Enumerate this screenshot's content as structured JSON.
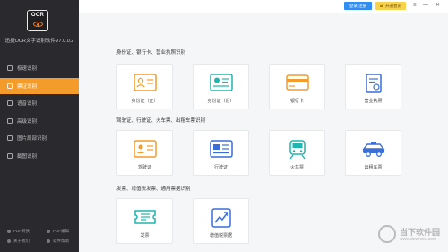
{
  "app": {
    "logo_text": "OCR",
    "title": "迅捷OCR文字识别软件V7.0.0.2"
  },
  "sidebar": {
    "items": [
      {
        "label": "极速识别",
        "active": false
      },
      {
        "label": "票证识别",
        "active": true
      },
      {
        "label": "语音识别",
        "active": false
      },
      {
        "label": "高级识别",
        "active": false
      },
      {
        "label": "图片局部识别",
        "active": false
      },
      {
        "label": "截图识别",
        "active": false
      }
    ],
    "footer": [
      "PDF转换",
      "PDF编辑",
      "关于我们",
      "软件帮助"
    ]
  },
  "topbar": {
    "login": "登录/注册",
    "vip": "开通会员",
    "menu": "≡",
    "minimize": "—",
    "close": "✕"
  },
  "sections": [
    {
      "title": "身份证、银行卡、营业执照识别",
      "cards": [
        {
          "label": "身份证（正）",
          "icon": "id-card-front-icon"
        },
        {
          "label": "身份证（反）",
          "icon": "id-card-back-icon"
        },
        {
          "label": "银行卡",
          "icon": "bank-card-icon"
        },
        {
          "label": "营业执照",
          "icon": "business-license-icon"
        }
      ]
    },
    {
      "title": "驾驶证、行驶证、火车票、出租车票识别",
      "cards": [
        {
          "label": "驾驶证",
          "icon": "driver-license-icon"
        },
        {
          "label": "行驶证",
          "icon": "vehicle-license-icon"
        },
        {
          "label": "火车票",
          "icon": "train-icon"
        },
        {
          "label": "出租车票",
          "icon": "taxi-icon"
        }
      ]
    },
    {
      "title": "发票、增值税发票、通用票据识别",
      "cards": [
        {
          "label": "发票",
          "icon": "invoice-icon"
        },
        {
          "label": "增值税票据",
          "icon": "vat-invoice-icon"
        }
      ]
    }
  ],
  "watermark": {
    "line1": "当下软件园",
    "line2": "www.downxia.com"
  },
  "colors": {
    "accent": "#f39c2b",
    "sidebar_bg": "#2a2a2e",
    "login_btn": "#2f8ef4",
    "vip_btn": "#f7d34c"
  }
}
